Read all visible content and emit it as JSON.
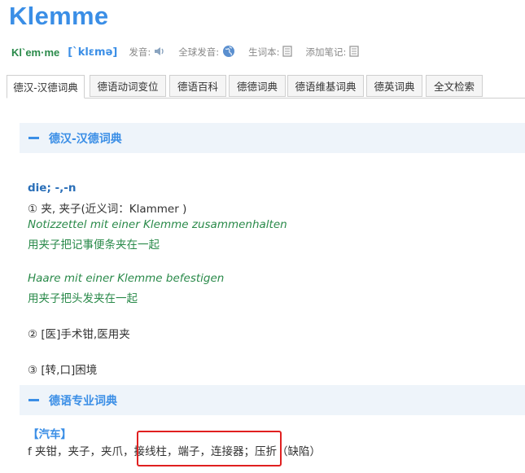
{
  "headword": "Klemme",
  "pronunciation": {
    "syllables": "Kl`em·me",
    "ipa": "[`klɛmə]",
    "pron_label": "发音:",
    "global_label": "全球发音:",
    "vocab_label": "生词本:",
    "note_label": "添加笔记:"
  },
  "tabs": [
    "德汉-汉德词典",
    "德语动词变位",
    "德语百科",
    "德德词典",
    "德语维基词典",
    "德英词典",
    "全文检索"
  ],
  "sections": {
    "dict": {
      "title": "德汉-汉德词典"
    },
    "specialist": {
      "title": "德语专业词典"
    }
  },
  "entry": {
    "grammar": "die; -,-n",
    "sense1": "① 夹, 夹子(近义词：Klammer )",
    "ex1_de": "Notizzettel mit einer Klemme zusammenhalten",
    "ex1_zh": "用夹子把记事便条夹在一起",
    "ex2_de": "Haare mit einer Klemme befestigen",
    "ex2_zh": "用夹子把头发夹在一起",
    "sense2": "② [医]手术钳,医用夹",
    "sense3": "③ [转,口]困境"
  },
  "specialist": {
    "category": "【汽车】",
    "definition": "f 夹钳，夹子，夹爪，接线柱，端子，连接器；压折（缺陷）"
  },
  "colors": {
    "accent": "#3a8ee6",
    "example_green": "#2a8a4a",
    "highlight_red": "#e02020"
  }
}
